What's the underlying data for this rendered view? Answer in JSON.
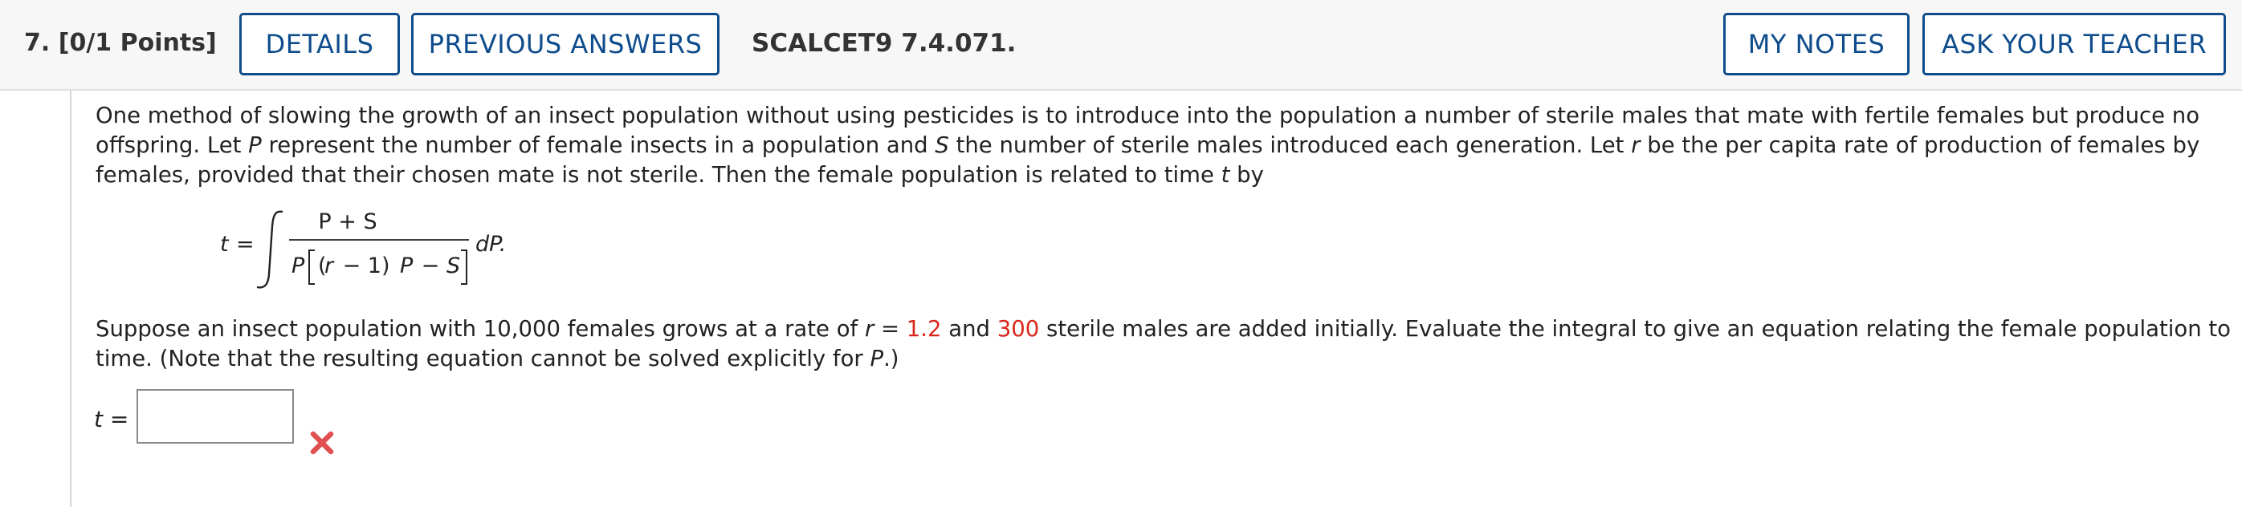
{
  "header": {
    "question_number": "7.",
    "points": "[0/1 Points]",
    "buttons": {
      "details": "DETAILS",
      "previous_answers": "PREVIOUS ANSWERS",
      "my_notes": "MY NOTES",
      "ask_teacher": "ASK YOUR TEACHER"
    },
    "question_id": "SCALCET9 7.4.071."
  },
  "problem": {
    "intro": {
      "s1": "One method of slowing the growth of an insect population without using pesticides is to introduce into the population a number of sterile males that mate with fertile females but produce no offspring. Let ",
      "v1": "P",
      "s2": " represent the number of female insects in a population and ",
      "v2": "S",
      "s3": " the number of sterile males introduced each generation. Let ",
      "v3": "r",
      "s4": " be the per capita rate of production of females by females, provided that their chosen mate is not sterile. Then the female population is related to time ",
      "v4": "t",
      "s5": " by"
    },
    "formula": {
      "lhs": "t",
      "equals": "=",
      "numerator": "P + S",
      "den_p": "P",
      "den_paren_open": "(",
      "den_r": "r",
      "den_mid": " − 1)",
      "den_p2": "P",
      "den_minus": " − ",
      "den_s": "S",
      "differential": "dP."
    },
    "question": {
      "s1": "Suppose an insect population with 10,000 females grows at a rate of ",
      "v1": "r",
      "s2": " = ",
      "r_value": "1.2",
      "s3": " and ",
      "males_value": "300",
      "s4": " sterile males are added initially. Evaluate the integral to give an equation relating the female population to time. (Note that the resulting equation cannot be solved explicitly for ",
      "v2": "P",
      "s5": ".)"
    }
  },
  "answer": {
    "label_var": "t",
    "label_eq": " =",
    "value": "",
    "status_icon": "x-mark-icon"
  },
  "colors": {
    "button_border": "#0e4c8c",
    "highlight_red": "#d9261c",
    "wrong_mark": "#e05050"
  }
}
